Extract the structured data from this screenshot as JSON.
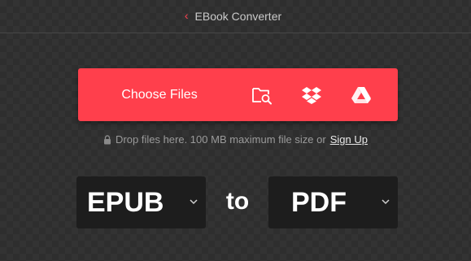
{
  "header": {
    "back_icon": "chevron-left-icon",
    "title": "EBook Converter"
  },
  "upload": {
    "choose_files_label": "Choose Files",
    "sources": [
      {
        "name": "folder-search-icon"
      },
      {
        "name": "dropbox-icon"
      },
      {
        "name": "google-drive-icon"
      }
    ],
    "accent_color": "#ff3f4c"
  },
  "hint": {
    "icon": "lock-icon",
    "text": "Drop files here. 100 MB maximum file size or",
    "signup_label": "Sign Up"
  },
  "converter": {
    "from_format": "EPUB",
    "connector": "to",
    "to_format": "PDF"
  }
}
